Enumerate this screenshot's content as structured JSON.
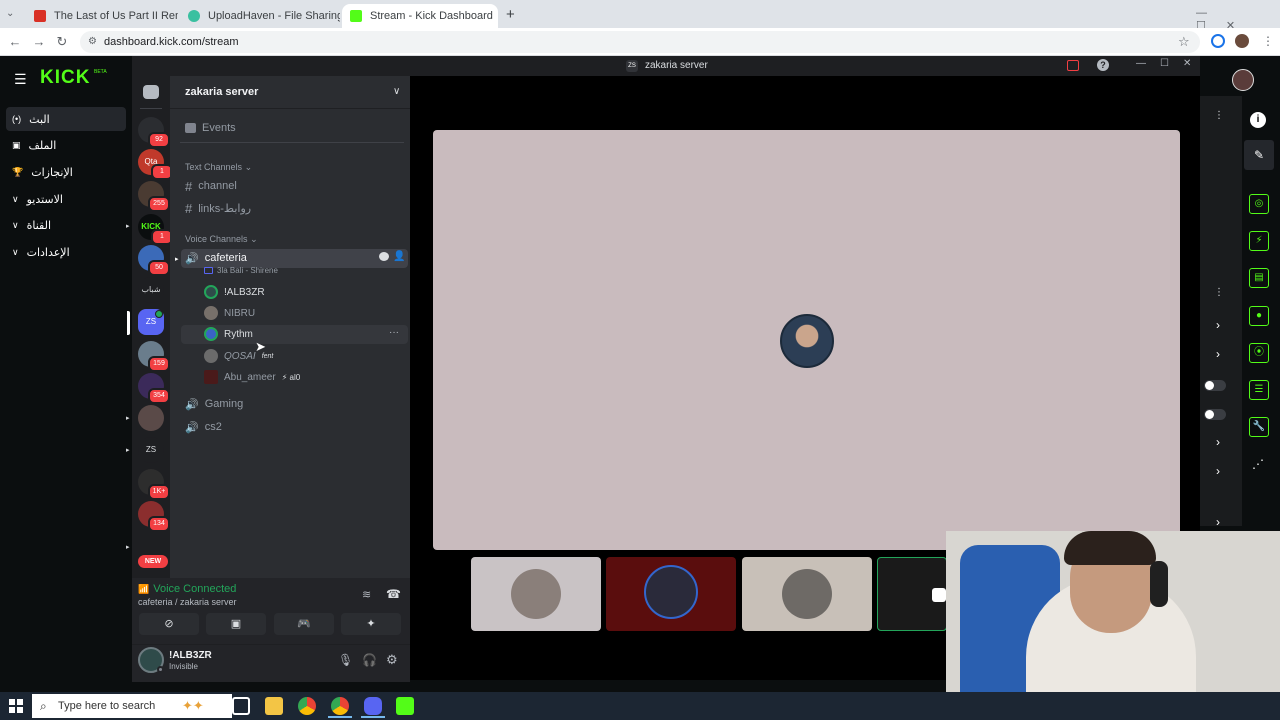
{
  "browser": {
    "tabs": [
      {
        "title": "The Last of Us Part II Remastere",
        "color": "#d93025"
      },
      {
        "title": "UploadHaven - File Sharing Ma",
        "color": "#3ac0a0"
      },
      {
        "title": "Stream - Kick Dashboard",
        "color": "#53fc18"
      }
    ],
    "new_tab": "+",
    "url": "dashboard.kick.com/stream",
    "tab_close": "✕"
  },
  "kick": {
    "logo": "KICK",
    "beta": "BETA",
    "nav": [
      {
        "label": "البث",
        "icon": "broadcast-icon"
      },
      {
        "label": "الملف",
        "icon": "profile-icon"
      },
      {
        "label": "الإنجازات",
        "icon": "trophy-icon"
      },
      {
        "label": "الاستديو",
        "icon": "chevron-down-icon"
      },
      {
        "label": "القناة",
        "icon": "chevron-down-icon"
      },
      {
        "label": "الإعدادات",
        "icon": "chevron-down-icon"
      }
    ]
  },
  "discord": {
    "window_title": "zakaria server",
    "window_badge": "ZS",
    "server_name": "zakaria server",
    "events": "Events",
    "text_category": "Text Channels",
    "text_channels": [
      "channel",
      "links-روابط"
    ],
    "voice_category": "Voice Channels",
    "active_voice": "cafeteria",
    "activity": "3la Bali - Shirene",
    "members": [
      {
        "name": "!ALB3ZR",
        "speaking": true
      },
      {
        "name": "NIBRU",
        "speaking": false
      },
      {
        "name": "Rythm",
        "speaking": true
      },
      {
        "name": "QOSAI",
        "speaking": false,
        "tag": "fent"
      },
      {
        "name": "Abu_ameer",
        "speaking": false,
        "tag": "⚡ al0"
      }
    ],
    "other_voice": [
      "Gaming",
      "cs2"
    ],
    "rail": [
      {
        "label": "",
        "badge": "92"
      },
      {
        "label": "Qta",
        "badge": "1"
      },
      {
        "label": "",
        "badge": "255"
      },
      {
        "label": "KICK BO",
        "badge": "1"
      },
      {
        "label": "",
        "badge": "50"
      },
      {
        "label": "شباب",
        "badge": ""
      },
      {
        "label": "ZS",
        "badge": ""
      },
      {
        "label": "",
        "badge": "159"
      },
      {
        "label": "",
        "badge": "354"
      },
      {
        "label": "",
        "badge": ""
      },
      {
        "label": "ZS",
        "badge": ""
      },
      {
        "label": "",
        "badge": "1K+"
      },
      {
        "label": "",
        "badge": "134"
      }
    ],
    "new_label": "NEW",
    "voice_status": "Voice Connected",
    "voice_location": "cafeteria / zakaria server",
    "user_name": "!ALB3ZR",
    "user_status": "Invisible"
  },
  "taskbar": {
    "search_placeholder": "Type here to search"
  },
  "colors": {
    "kick_green": "#53fc18",
    "discord_green": "#23a55a",
    "stream_card": "#c9bbbe"
  }
}
